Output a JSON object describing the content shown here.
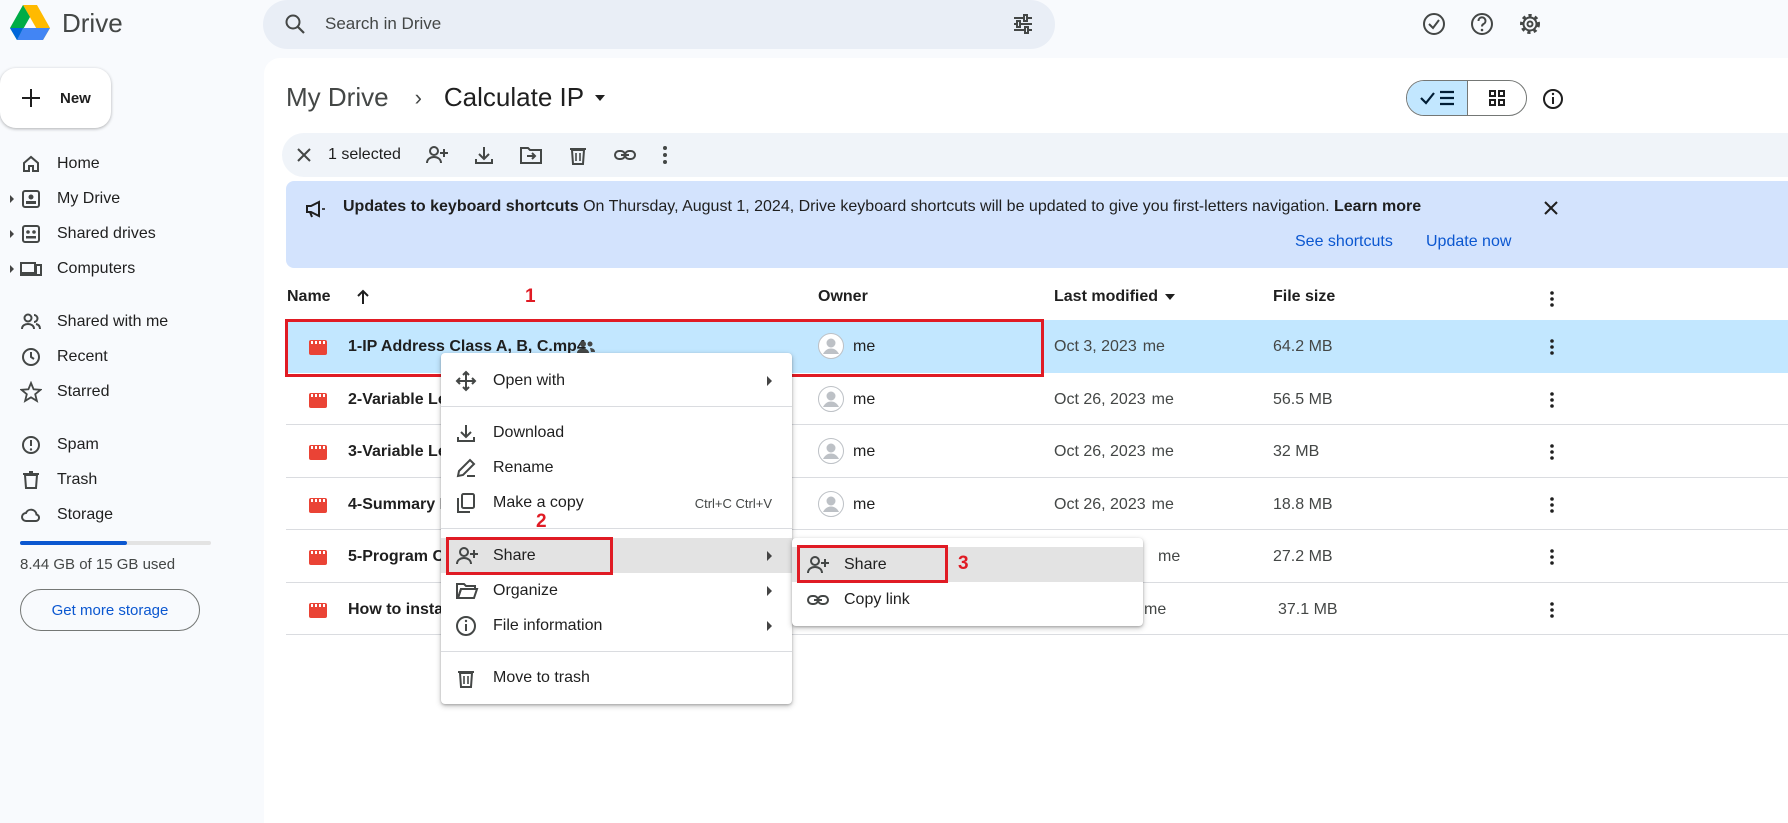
{
  "app": {
    "title": "Drive"
  },
  "search": {
    "placeholder": "Search in Drive"
  },
  "sidebar": {
    "new_label": "New",
    "items": [
      {
        "label": "Home"
      },
      {
        "label": "My Drive"
      },
      {
        "label": "Shared drives"
      },
      {
        "label": "Computers"
      },
      {
        "label": "Shared with me"
      },
      {
        "label": "Recent"
      },
      {
        "label": "Starred"
      },
      {
        "label": "Spam"
      },
      {
        "label": "Trash"
      },
      {
        "label": "Storage"
      }
    ],
    "storage_used_fraction": 0.56,
    "storage_text": "8.44 GB of 15 GB used",
    "get_storage_label": "Get more storage"
  },
  "breadcrumb": {
    "root": "My Drive",
    "sep": "›",
    "current": "Calculate IP"
  },
  "selection": {
    "text": "1 selected"
  },
  "banner": {
    "title": "Updates to keyboard shortcuts",
    "message": "On Thursday, August 1, 2024, Drive keyboard shortcuts will be updated to give you first-letters navigation.",
    "learn_more": "Learn more",
    "see_shortcuts": "See shortcuts",
    "update_now": "Update now"
  },
  "table": {
    "columns": {
      "name": "Name",
      "owner": "Owner",
      "last_modified": "Last modified",
      "file_size": "File size"
    },
    "rows": [
      {
        "name": "1-IP Address Class A, B, C.mp4",
        "owner": "me",
        "date": "Oct 3, 2023",
        "by": "me",
        "size": "64.2 MB"
      },
      {
        "name": "2-Variable Le",
        "owner": "me",
        "date": "Oct 26, 2023",
        "by": "me",
        "size": "56.5 MB"
      },
      {
        "name": "3-Variable Le",
        "owner": "me",
        "date": "Oct 26, 2023",
        "by": "me",
        "size": "32 MB"
      },
      {
        "name": "4-Summary I",
        "owner": "me",
        "date": "Oct 26, 2023",
        "by": "me",
        "size": "18.8 MB"
      },
      {
        "name": "5-Program C",
        "owner": "",
        "date": "",
        "by": "me",
        "size": "27.2 MB"
      },
      {
        "name": "How to instal",
        "owner": "",
        "date": "",
        "by": "me",
        "size": "37.1 MB"
      }
    ]
  },
  "context_menu": {
    "open_with": "Open with",
    "download": "Download",
    "rename": "Rename",
    "make_copy": "Make a copy",
    "make_copy_shortcut": "Ctrl+C Ctrl+V",
    "share": "Share",
    "organize": "Organize",
    "file_information": "File information",
    "move_to_trash": "Move to trash"
  },
  "share_submenu": {
    "share": "Share",
    "copy_link": "Copy link"
  },
  "annotations": {
    "n1": "1",
    "n2": "2",
    "n3": "3",
    "color": "#e01b24"
  },
  "colors": {
    "accent": "#0b57d0",
    "selected_row": "#c2e7ff",
    "banner": "#d3e3fd",
    "file_icon": "#ea4335"
  }
}
